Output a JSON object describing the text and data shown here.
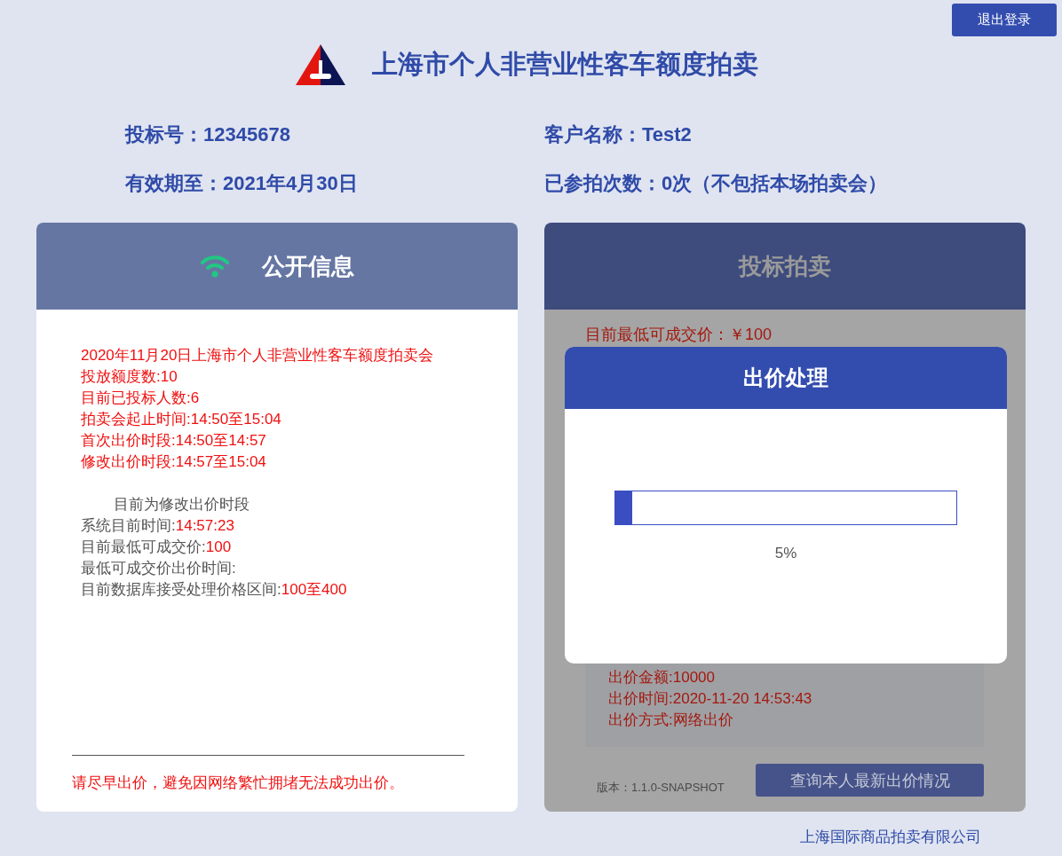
{
  "logout_button": "退出登录",
  "header": {
    "title": "上海市个人非营业性客车额度拍卖"
  },
  "bidder_info": [
    "投标号：12345678",
    "客户名称：Test2",
    "有效期至：2021年4月30日",
    "已参拍次数：0次（不包括本场拍卖会）"
  ],
  "public_info": {
    "title": "公开信息",
    "lines": [
      {
        "kind": "alert",
        "label": "2020年11月20日上海市个人非营业性客车额度拍卖会"
      },
      {
        "kind": "alert",
        "label": "投放额度数:10"
      },
      {
        "kind": "alert",
        "label": "目前已投标人数:6"
      },
      {
        "kind": "alert",
        "label": "拍卖会起止时间:14:50至15:04"
      },
      {
        "kind": "alert",
        "label": "首次出价时段:14:50至14:57"
      },
      {
        "kind": "alert",
        "label": "修改出价时段:14:57至15:04"
      },
      {
        "kind": "status",
        "label": "目前为修改出价时段"
      },
      {
        "kind": "normal",
        "label": "系统目前时间:",
        "value": "14:57:23"
      },
      {
        "kind": "normal",
        "label": "目前最低可成交价:",
        "value": "100"
      },
      {
        "kind": "normal",
        "label": "最低可成交价出价时间:"
      },
      {
        "kind": "normal",
        "label": "目前数据库接受处理价格区间:",
        "value": "100至400"
      }
    ],
    "notice": "请尽早出价，避免因网络繁忙拥堵无法成功出价。"
  },
  "bidding": {
    "title": "投标拍卖",
    "lowest_price": "目前最低可成交价：￥100",
    "bid_record": [
      "出价金额:10000",
      "出价时间:2020-11-20 14:53:43",
      "出价方式:网络出价"
    ],
    "version": "版本：1.1.0-SNAPSHOT",
    "query_button": "查询本人最新出价情况"
  },
  "dialog": {
    "title": "出价处理",
    "level": 0.05,
    "percent": "5%"
  },
  "footer": "上海国际商品拍卖有限公司"
}
